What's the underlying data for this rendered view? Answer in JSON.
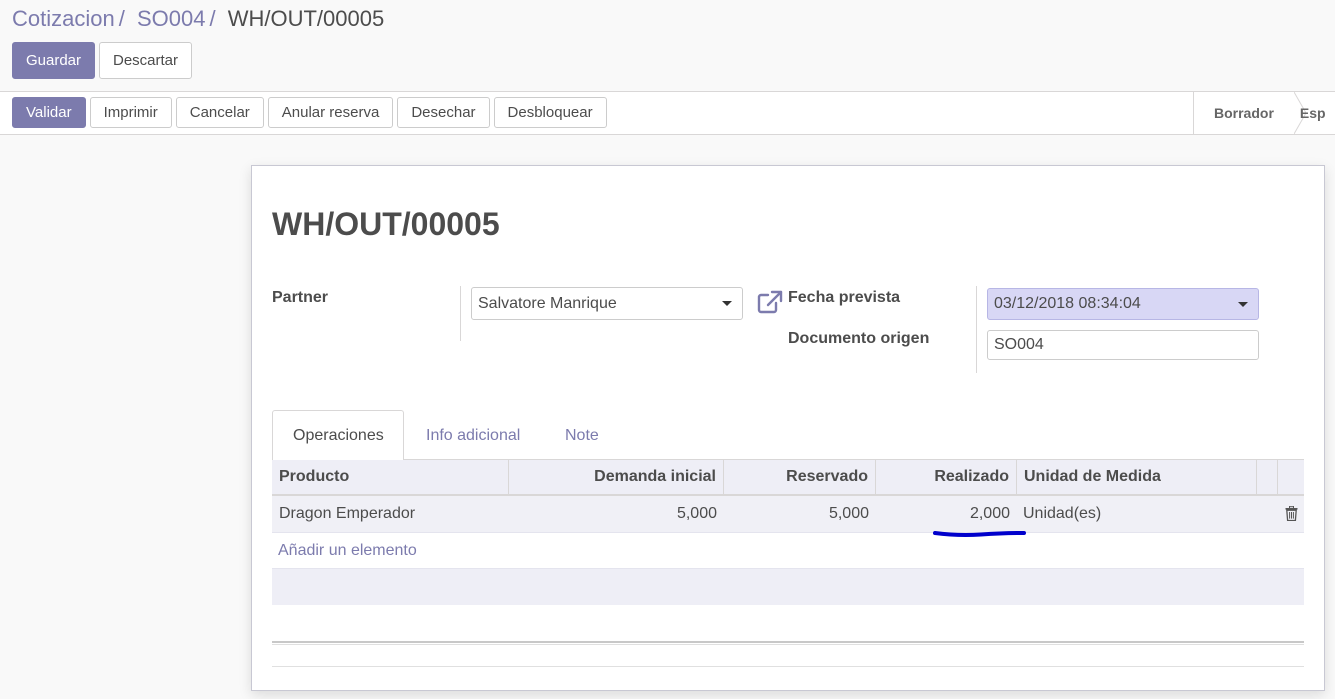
{
  "breadcrumb": {
    "items": [
      "Cotizacion",
      "SO004"
    ],
    "separator": "/",
    "current": "WH/OUT/00005"
  },
  "control": {
    "save_label": "Guardar",
    "discard_label": "Descartar"
  },
  "statusbar": {
    "buttons": [
      "Validar",
      "Imprimir",
      "Cancelar",
      "Anular reserva",
      "Desechar",
      "Desbloquear"
    ],
    "steps": [
      "Borrador",
      "Esp"
    ]
  },
  "record": {
    "title": "WH/OUT/00005",
    "partner_label": "Partner",
    "partner_value": "Salvatore Manrique",
    "scheduled_label": "Fecha prevista",
    "scheduled_value": "03/12/2018 08:34:04",
    "origin_label": "Documento origen",
    "origin_value": "SO004"
  },
  "tabs": [
    "Operaciones",
    "Info adicional",
    "Note"
  ],
  "table": {
    "headers": [
      "Producto",
      "Demanda inicial",
      "Reservado",
      "Realizado",
      "Unidad de Medida"
    ],
    "rows": [
      {
        "product": "Dragon Emperador",
        "demand": "5,000",
        "reserved": "5,000",
        "done": "2,000",
        "uom": "Unidad(es)"
      }
    ],
    "add_label": "Añadir un elemento"
  },
  "colors": {
    "primary": "#7c7bad",
    "annotation": "#0000cc",
    "selected_field": "#d8d7f5"
  }
}
